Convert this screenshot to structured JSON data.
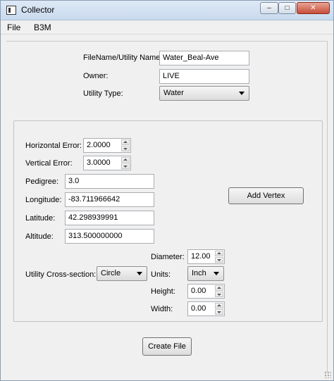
{
  "window": {
    "title": "Collector",
    "min_glyph": "–",
    "max_glyph": "□",
    "close_glyph": "✕"
  },
  "menubar": {
    "items": [
      "File",
      "B3M"
    ]
  },
  "header_form": {
    "filename_label": "FileName/Utility Name:",
    "filename_value": "Water_Beal-Ave",
    "owner_label": "Owner:",
    "owner_value": "LIVE",
    "utility_type_label": "Utility Type:",
    "utility_type_value": "Water"
  },
  "vertex_form": {
    "horizontal_error_label": "Horizontal Error:",
    "horizontal_error_value": "2.0000",
    "vertical_error_label": "Vertical Error:",
    "vertical_error_value": "3.0000",
    "pedigree_label": "Pedigree:",
    "pedigree_value": "3.0",
    "longitude_label": "Longitude:",
    "longitude_value": "-83.711966642",
    "latitude_label": "Latitude:",
    "latitude_value": "42.298939991",
    "altitude_label": "Altitude:",
    "altitude_value": "313.500000000",
    "add_vertex_label": "Add Vertex"
  },
  "cross_section": {
    "label": "Utility Cross-section:",
    "value": "Circle",
    "diameter_label": "Diameter:",
    "diameter_value": "12.00",
    "units_label": "Units:",
    "units_value": "Inch",
    "height_label": "Height:",
    "height_value": "0.00",
    "width_label": "Width:",
    "width_value": "0.00"
  },
  "footer": {
    "create_file_label": "Create File"
  }
}
